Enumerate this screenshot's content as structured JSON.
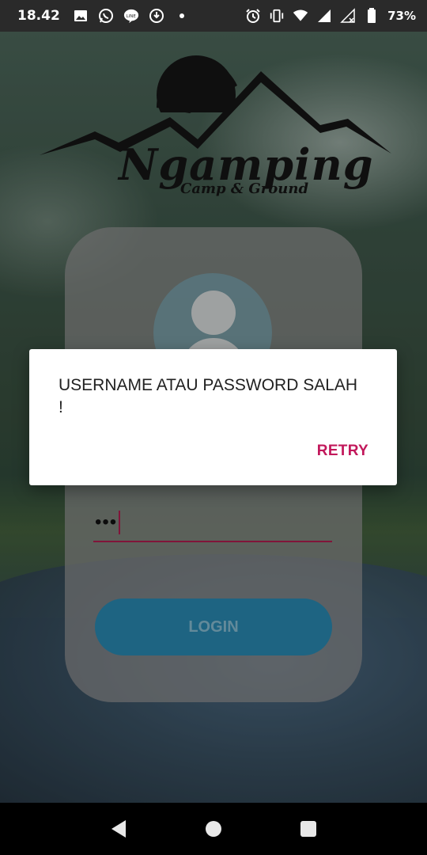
{
  "status_bar": {
    "time": "18.42",
    "battery": "73%",
    "icons_left": [
      "gallery-icon",
      "whatsapp-icon",
      "line-icon",
      "download-icon",
      "dot-icon"
    ],
    "icons_right": [
      "alarm-icon",
      "vibrate-icon",
      "wifi-icon",
      "signal-icon",
      "signal-no-data-icon",
      "battery-icon"
    ]
  },
  "logo": {
    "title": "Ngamping",
    "subtitle": "Camp & Ground"
  },
  "login": {
    "password_value": "•••",
    "login_label": "LOGIN"
  },
  "dialog": {
    "message": "USERNAME ATAU PASSWORD SALAH !",
    "retry_label": "RETRY"
  },
  "colors": {
    "accent": "#c2185b",
    "button": "#2a8bb4",
    "underline": "#b31d4f"
  }
}
